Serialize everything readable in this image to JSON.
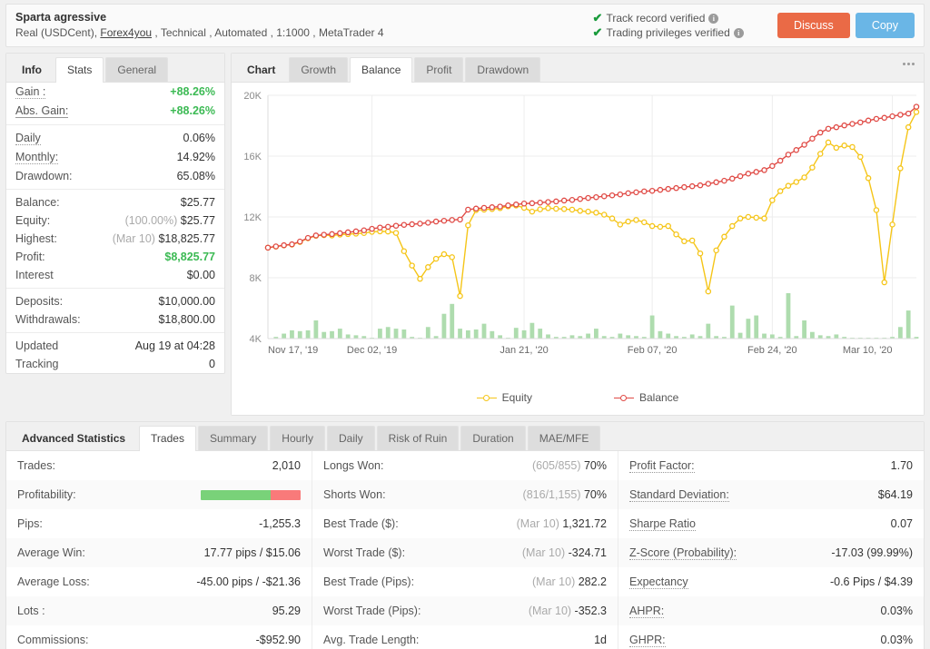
{
  "header": {
    "account_name": "Sparta agressive",
    "account_meta_prefix": "Real (USDCent), ",
    "broker": "Forex4you",
    "account_meta_suffix": " , Technical , Automated , 1:1000 , MetaTrader 4",
    "verified": [
      {
        "label": "Track record verified",
        "info": "i"
      },
      {
        "label": "Trading privileges verified",
        "info": "i"
      }
    ],
    "check_glyph": "✔",
    "discuss_label": "Discuss",
    "copy_label": "Copy",
    "colors": {
      "discuss": "#ea6a46",
      "copy": "#6ab6e6",
      "check": "#1a9b3c"
    }
  },
  "stats_panel": {
    "tabs": [
      {
        "label": "Info",
        "active": false,
        "is_title": true
      },
      {
        "label": "Stats",
        "active": true,
        "is_title": false
      },
      {
        "label": "General",
        "active": false,
        "is_title": false
      }
    ],
    "group1": [
      {
        "label": "Gain :",
        "value": "+88.26%",
        "green": true,
        "underline": "dashed"
      },
      {
        "label": "Abs. Gain:",
        "value": "+88.26%",
        "green": true,
        "underline": "solid"
      }
    ],
    "group2": [
      {
        "label": "Daily",
        "value": "0.06%",
        "underline": "dashed"
      },
      {
        "label": "Monthly:",
        "value": "14.92%",
        "underline": "dashed"
      },
      {
        "label": "Drawdown:",
        "value": "65.08%",
        "underline": "none"
      }
    ],
    "group3": [
      {
        "label": "Balance:",
        "value": "$25.77",
        "prefix": "",
        "underline": "none"
      },
      {
        "label": "Equity:",
        "value": "$25.77",
        "prefix": "(100.00%)",
        "underline": "none"
      },
      {
        "label": "Highest:",
        "value": "$18,825.77",
        "prefix": "(Mar 10)",
        "underline": "none"
      },
      {
        "label": "Profit:",
        "value": "$8,825.77",
        "prefix": "",
        "green": true,
        "underline": "none"
      },
      {
        "label": "Interest",
        "value": "$0.00",
        "prefix": "",
        "underline": "none"
      }
    ],
    "group4": [
      {
        "label": "Deposits:",
        "value": "$10,000.00"
      },
      {
        "label": "Withdrawals:",
        "value": "$18,800.00"
      }
    ],
    "group5": [
      {
        "label": "Updated",
        "value": "Aug 19 at 04:28"
      },
      {
        "label": "Tracking",
        "value": "0"
      }
    ]
  },
  "chart_panel": {
    "tabs": [
      {
        "label": "Chart",
        "active": false,
        "is_title": true
      },
      {
        "label": "Growth",
        "active": false,
        "is_title": false
      },
      {
        "label": "Balance",
        "active": true,
        "is_title": false
      },
      {
        "label": "Profit",
        "active": false,
        "is_title": false
      },
      {
        "label": "Drawdown",
        "active": false,
        "is_title": false
      }
    ],
    "menu_icon": "more-options"
  },
  "chart_data": {
    "type": "line",
    "title": "Balance",
    "xlabel": "",
    "ylabel": "",
    "ylim": [
      4000,
      20000
    ],
    "yticks": [
      4000,
      8000,
      12000,
      16000,
      20000
    ],
    "ytick_labels": [
      "4K",
      "8K",
      "12K",
      "16K",
      "20K"
    ],
    "grid": true,
    "legend_position": "bottom",
    "xtick_labels": [
      "Nov 17, '19",
      "Dec 02, '19",
      "Jan 21, '20",
      "Feb 07, '20",
      "Feb 24, '20",
      "Mar 10, '20"
    ],
    "xtick_positions": [
      0,
      13,
      32,
      48,
      63,
      78
    ],
    "n_points": 82,
    "series": [
      {
        "name": "Equity",
        "color": "#f5c518",
        "values": [
          9980,
          10050,
          10130,
          10180,
          10350,
          10600,
          10760,
          10800,
          10780,
          10840,
          10870,
          10900,
          10940,
          11020,
          11050,
          11040,
          10950,
          9750,
          8800,
          7930,
          8700,
          9250,
          9550,
          9350,
          6800,
          11450,
          12450,
          12480,
          12520,
          12580,
          12700,
          12750,
          12600,
          12350,
          12500,
          12580,
          12540,
          12520,
          12480,
          12400,
          12350,
          12280,
          12150,
          11900,
          11500,
          11700,
          11800,
          11650,
          11400,
          11350,
          11400,
          10850,
          10400,
          10450,
          9600,
          7100,
          9800,
          10700,
          11400,
          11900,
          12000,
          11950,
          11900,
          13100,
          13700,
          14050,
          14300,
          14600,
          15250,
          16150,
          16900,
          16550,
          16700,
          16600,
          15950,
          14550,
          12450,
          7700,
          11500,
          15200,
          17900,
          18900
        ]
      },
      {
        "name": "Balance",
        "color": "#e04a45",
        "values": [
          9980,
          10060,
          10140,
          10200,
          10380,
          10620,
          10780,
          10830,
          10870,
          10930,
          10990,
          11050,
          11120,
          11220,
          11300,
          11350,
          11420,
          11480,
          11520,
          11560,
          11620,
          11700,
          11750,
          11800,
          11830,
          12480,
          12550,
          12600,
          12640,
          12680,
          12760,
          12820,
          12880,
          12900,
          12940,
          12980,
          13020,
          13080,
          13120,
          13180,
          13250,
          13300,
          13360,
          13420,
          13480,
          13560,
          13620,
          13680,
          13720,
          13780,
          13840,
          13900,
          13960,
          14020,
          14080,
          14180,
          14280,
          14380,
          14520,
          14680,
          14850,
          14960,
          15080,
          15350,
          15700,
          16100,
          16400,
          16750,
          17150,
          17550,
          17800,
          17900,
          18020,
          18120,
          18220,
          18340,
          18450,
          18520,
          18620,
          18720,
          18800,
          19250
        ]
      }
    ],
    "volume_bars": {
      "name": "Volume",
      "color": "#aedcae",
      "values": [
        0,
        2,
        6,
        10,
        9,
        10,
        22,
        8,
        9,
        12,
        5,
        4,
        3,
        1,
        12,
        14,
        12,
        11,
        2,
        1,
        14,
        3,
        30,
        42,
        12,
        10,
        11,
        18,
        9,
        4,
        1,
        13,
        10,
        19,
        12,
        5,
        2,
        2,
        4,
        3,
        6,
        12,
        3,
        2,
        6,
        4,
        3,
        2,
        28,
        9,
        6,
        3,
        2,
        5,
        3,
        18,
        3,
        2,
        40,
        7,
        24,
        28,
        6,
        5,
        2,
        55,
        3,
        22,
        8,
        4,
        3,
        5,
        2,
        1,
        1,
        1,
        1,
        1,
        2,
        14,
        34,
        2
      ]
    }
  },
  "bottom_panel": {
    "tabs": [
      {
        "label": "Advanced Statistics",
        "active": false,
        "is_title": true
      },
      {
        "label": "Trades",
        "active": true,
        "is_title": false
      },
      {
        "label": "Summary",
        "active": false,
        "is_title": false
      },
      {
        "label": "Hourly",
        "active": false,
        "is_title": false
      },
      {
        "label": "Daily",
        "active": false,
        "is_title": false
      },
      {
        "label": "Risk of Ruin",
        "active": false,
        "is_title": false
      },
      {
        "label": "Duration",
        "active": false,
        "is_title": false
      },
      {
        "label": "MAE/MFE",
        "active": false,
        "is_title": false
      }
    ],
    "column1": [
      {
        "key": "Trades:",
        "value": "2,010",
        "underline": "none",
        "type": "text"
      },
      {
        "key": "Profitability:",
        "value": "",
        "underline": "none",
        "type": "bar",
        "win_pct": 70,
        "loss_pct": 30,
        "win_color": "#79d279",
        "loss_color": "#f97a7a"
      },
      {
        "key": "Pips:",
        "value": "-1,255.3",
        "underline": "none",
        "type": "text"
      },
      {
        "key": "Average Win:",
        "value": "17.77 pips / $15.06",
        "underline": "none",
        "type": "text"
      },
      {
        "key": "Average Loss:",
        "value": "-45.00 pips / -$21.36",
        "underline": "none",
        "type": "text"
      },
      {
        "key": "Lots :",
        "value": "95.29",
        "underline": "none",
        "type": "text"
      },
      {
        "key": "Commissions:",
        "value": "-$952.90",
        "underline": "none",
        "type": "text"
      }
    ],
    "column2": [
      {
        "key": "Longs Won:",
        "prefix": "(605/855)",
        "value": "70%",
        "underline": "none",
        "type": "text"
      },
      {
        "key": "Shorts Won:",
        "prefix": "(816/1,155)",
        "value": "70%",
        "underline": "none",
        "type": "text"
      },
      {
        "key": "Best Trade ($):",
        "prefix": "(Mar 10)",
        "value": "1,321.72",
        "underline": "none",
        "type": "text"
      },
      {
        "key": "Worst Trade ($):",
        "prefix": "(Mar 10)",
        "value": "-324.71",
        "underline": "none",
        "type": "text"
      },
      {
        "key": "Best Trade (Pips):",
        "prefix": "(Mar 10)",
        "value": "282.2",
        "underline": "none",
        "type": "text"
      },
      {
        "key": "Worst Trade (Pips):",
        "prefix": "(Mar 10)",
        "value": "-352.3",
        "underline": "none",
        "type": "text"
      },
      {
        "key": "Avg. Trade Length:",
        "prefix": "",
        "value": "1d",
        "underline": "none",
        "type": "text"
      }
    ],
    "column3": [
      {
        "key": "Profit Factor:",
        "value": "1.70",
        "underline": "dashed",
        "type": "text"
      },
      {
        "key": "Standard Deviation:",
        "value": "$64.19",
        "underline": "dashed",
        "type": "text"
      },
      {
        "key": "Sharpe Ratio",
        "value": "0.07",
        "underline": "dashed",
        "type": "text"
      },
      {
        "key": "Z-Score (Probability):",
        "value": "-17.03 (99.99%)",
        "underline": "dashed",
        "type": "text"
      },
      {
        "key": "Expectancy",
        "value": "-0.6 Pips / $4.39",
        "underline": "dashed",
        "type": "text"
      },
      {
        "key": "AHPR:",
        "value": "0.03%",
        "underline": "dashed",
        "type": "text"
      },
      {
        "key": "GHPR:",
        "value": "0.03%",
        "underline": "dashed",
        "type": "text"
      }
    ]
  }
}
